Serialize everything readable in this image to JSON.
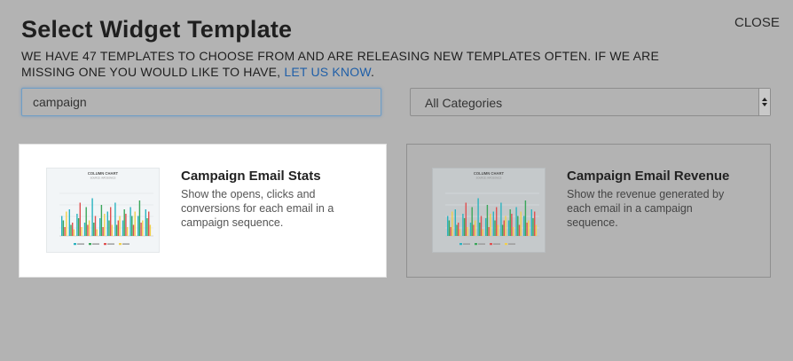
{
  "header": {
    "title": "Select Widget Template",
    "close_label": "CLOSE",
    "subtitle_text": "WE HAVE 47 TEMPLATES TO CHOOSE FROM AND ARE RELEASING NEW TEMPLATES OFTEN. IF WE ARE MISSING ONE YOU WOULD LIKE TO HAVE, ",
    "subtitle_link": "LET US KNOW",
    "subtitle_end": "."
  },
  "filters": {
    "search_value": "campaign",
    "category_selected": "All Categories"
  },
  "templates": [
    {
      "title": "Campaign Email Stats",
      "description": "Show the opens, clicks and conversions for each email in a campaign sequence.",
      "selected": true,
      "thumbnail_title": "COLUMN CHART",
      "thumbnail_subtitle": "SOURCE: INFOSONICS"
    },
    {
      "title": "Campaign Email Revenue",
      "description": "Show the revenue generated by each email in a campaign sequence.",
      "selected": false,
      "thumbnail_title": "COLUMN CHART",
      "thumbnail_subtitle": "SOURCE: INFOSONICS"
    }
  ],
  "colors": {
    "overlay": "#b3b3b3",
    "link": "#1f5fa8",
    "series": [
      "#2bb3c0",
      "#3aa65a",
      "#e05050",
      "#f2d04a"
    ]
  }
}
